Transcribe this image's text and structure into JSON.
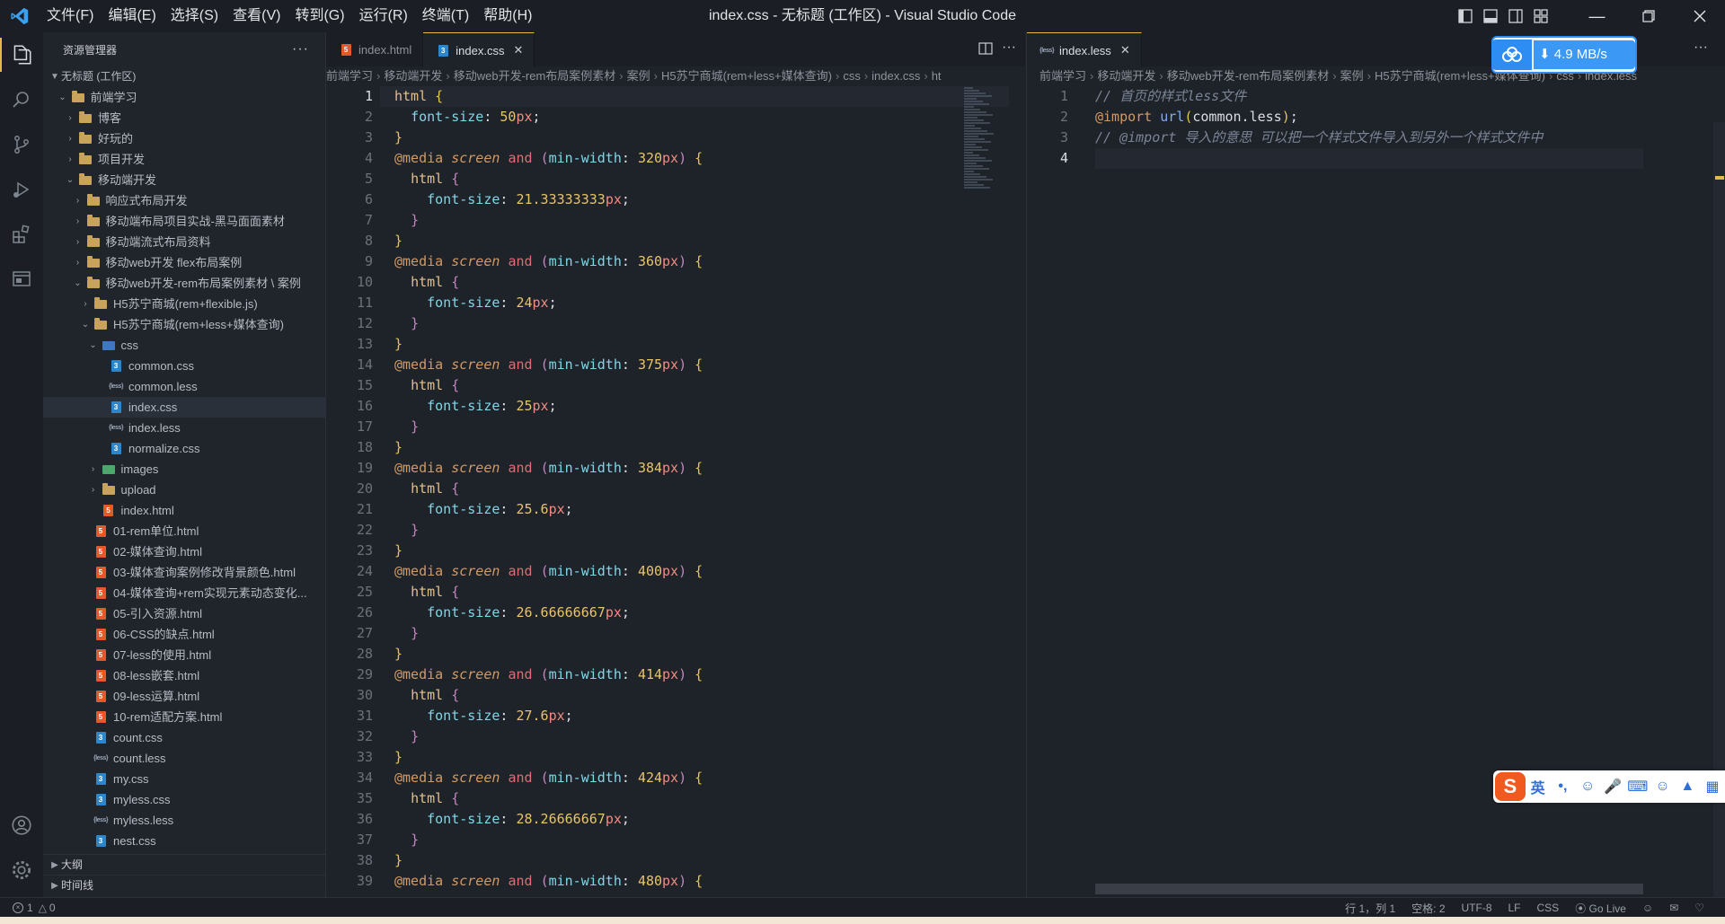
{
  "titlebar": {
    "menus": [
      "文件(F)",
      "编辑(E)",
      "选择(S)",
      "查看(V)",
      "转到(G)",
      "运行(R)",
      "终端(T)",
      "帮助(H)"
    ],
    "window_title": "index.css - 无标题 (工作区) - Visual Studio Code"
  },
  "sidebar": {
    "header": "资源管理器",
    "workspace": "无标题 (工作区)",
    "tree": [
      {
        "label": "前端学习",
        "indent": 1,
        "type": "folder-open",
        "chev": "down"
      },
      {
        "label": "博客",
        "indent": 2,
        "type": "folder",
        "chev": "right"
      },
      {
        "label": "好玩的",
        "indent": 2,
        "type": "folder",
        "chev": "right"
      },
      {
        "label": "项目开发",
        "indent": 2,
        "type": "folder",
        "chev": "right"
      },
      {
        "label": "移动端开发",
        "indent": 2,
        "type": "folder-open",
        "chev": "down"
      },
      {
        "label": "响应式布局开发",
        "indent": 3,
        "type": "folder",
        "chev": "right"
      },
      {
        "label": "移动端布局项目实战-黑马面面素材",
        "indent": 3,
        "type": "folder",
        "chev": "right"
      },
      {
        "label": "移动端流式布局资料",
        "indent": 3,
        "type": "folder",
        "chev": "right"
      },
      {
        "label": "移动web开发 flex布局案例",
        "indent": 3,
        "type": "folder",
        "chev": "right"
      },
      {
        "label": "移动web开发-rem布局案例素材 \\ 案例",
        "indent": 3,
        "type": "folder-open",
        "chev": "down"
      },
      {
        "label": "H5苏宁商城(rem+flexible.js)",
        "indent": 4,
        "type": "folder",
        "chev": "right"
      },
      {
        "label": "H5苏宁商城(rem+less+媒体查询)",
        "indent": 4,
        "type": "folder-open",
        "chev": "down"
      },
      {
        "label": "css",
        "indent": 5,
        "type": "folder-css",
        "chev": "down"
      },
      {
        "label": "common.css",
        "indent": 6,
        "type": "css",
        "chev": ""
      },
      {
        "label": "common.less",
        "indent": 6,
        "type": "less",
        "chev": ""
      },
      {
        "label": "index.css",
        "indent": 6,
        "type": "css",
        "chev": "",
        "selected": true
      },
      {
        "label": "index.less",
        "indent": 6,
        "type": "less",
        "chev": ""
      },
      {
        "label": "normalize.css",
        "indent": 6,
        "type": "css",
        "chev": ""
      },
      {
        "label": "images",
        "indent": 5,
        "type": "folder-img",
        "chev": "right"
      },
      {
        "label": "upload",
        "indent": 5,
        "type": "folder",
        "chev": "right"
      },
      {
        "label": "index.html",
        "indent": 5,
        "type": "html",
        "chev": ""
      },
      {
        "label": "01-rem单位.html",
        "indent": 4,
        "type": "html",
        "chev": ""
      },
      {
        "label": "02-媒体查询.html",
        "indent": 4,
        "type": "html",
        "chev": ""
      },
      {
        "label": "03-媒体查询案例修改背景颜色.html",
        "indent": 4,
        "type": "html",
        "chev": ""
      },
      {
        "label": "04-媒体查询+rem实现元素动态变化...",
        "indent": 4,
        "type": "html",
        "chev": ""
      },
      {
        "label": "05-引入资源.html",
        "indent": 4,
        "type": "html",
        "chev": ""
      },
      {
        "label": "06-CSS的缺点.html",
        "indent": 4,
        "type": "html",
        "chev": ""
      },
      {
        "label": "07-less的使用.html",
        "indent": 4,
        "type": "html",
        "chev": ""
      },
      {
        "label": "08-less嵌套.html",
        "indent": 4,
        "type": "html",
        "chev": ""
      },
      {
        "label": "09-less运算.html",
        "indent": 4,
        "type": "html",
        "chev": ""
      },
      {
        "label": "10-rem适配方案.html",
        "indent": 4,
        "type": "html",
        "chev": ""
      },
      {
        "label": "count.css",
        "indent": 4,
        "type": "css",
        "chev": ""
      },
      {
        "label": "count.less",
        "indent": 4,
        "type": "less",
        "chev": ""
      },
      {
        "label": "my.css",
        "indent": 4,
        "type": "css",
        "chev": ""
      },
      {
        "label": "myless.css",
        "indent": 4,
        "type": "css",
        "chev": ""
      },
      {
        "label": "myless.less",
        "indent": 4,
        "type": "less",
        "chev": ""
      },
      {
        "label": "nest.css",
        "indent": 4,
        "type": "css",
        "chev": ""
      }
    ],
    "outline": "大纲",
    "timeline": "时间线"
  },
  "left_group": {
    "tabs": [
      {
        "label": "index.html",
        "type": "html",
        "active": false
      },
      {
        "label": "index.css",
        "type": "css",
        "active": true
      }
    ],
    "breadcrumb": [
      "前端学习",
      "移动端开发",
      "移动web开发-rem布局案例素材",
      "案例",
      "H5苏宁商城(rem+less+媒体查询)",
      "css",
      "index.css",
      "ht"
    ]
  },
  "css_code": {
    "breakpoints": [
      {
        "min_width": "320",
        "font_size": "21.33333333"
      },
      {
        "min_width": "360",
        "font_size": "24"
      },
      {
        "min_width": "375",
        "font_size": "25"
      },
      {
        "min_width": "384",
        "font_size": "25.6"
      },
      {
        "min_width": "400",
        "font_size": "26.66666667"
      },
      {
        "min_width": "414",
        "font_size": "27.6"
      },
      {
        "min_width": "424",
        "font_size": "28.26666667"
      },
      {
        "min_width": "480",
        "font_size": ""
      }
    ],
    "root_font_size": "50"
  },
  "right_group": {
    "tabs": [
      {
        "label": "index.less",
        "type": "less",
        "active": true
      }
    ],
    "breadcrumb": [
      "前端学习",
      "移动端开发",
      "移动web开发-rem布局案例素材",
      "案例",
      "H5苏宁商城(rem+less+媒体查询)",
      "css",
      "index.less"
    ],
    "lines": [
      "// 首页的样式less文件",
      "@import url(common.less);",
      "// @import 导入的意思 可以把一个样式文件导入到另外一个样式文件中",
      ""
    ]
  },
  "statusbar": {
    "errors": "1",
    "warnings": "0",
    "position": "行 1，列 1",
    "spaces": "空格: 2",
    "encoding": "UTF-8",
    "eol": "LF",
    "language": "CSS",
    "golive": "Go Live"
  },
  "net_widget": {
    "speed": "4.9 MB/s"
  },
  "ime": {
    "mode": "英",
    "punct": "•,"
  }
}
